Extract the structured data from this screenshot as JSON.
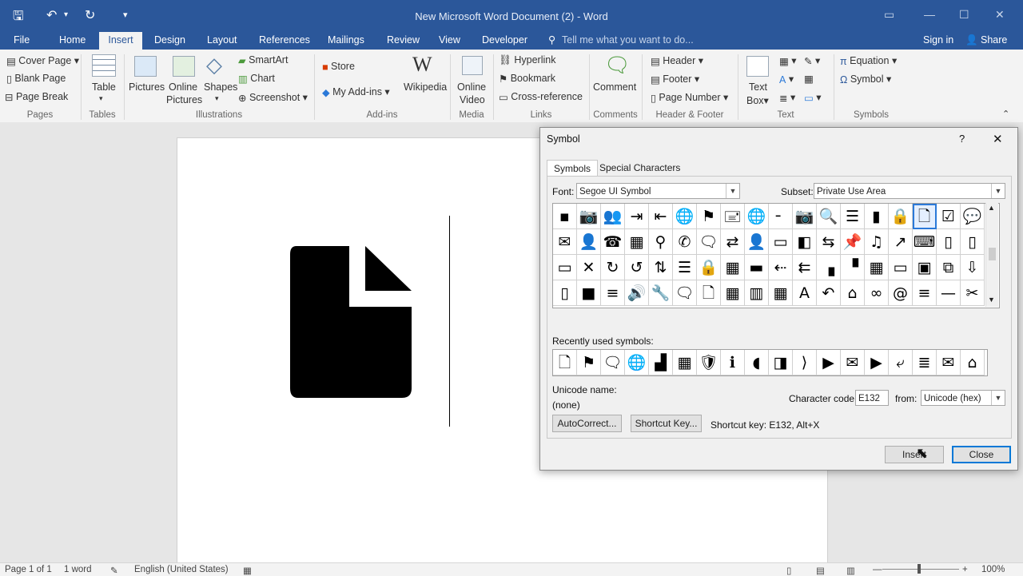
{
  "window": {
    "title": "New Microsoft Word Document (2) - Word"
  },
  "tabs": {
    "file": "File",
    "home": "Home",
    "insert": "Insert",
    "design": "Design",
    "layout": "Layout",
    "references": "References",
    "mailings": "Mailings",
    "review": "Review",
    "view": "View",
    "developer": "Developer",
    "tell_me": "Tell me what you want to do...",
    "sign_in": "Sign in",
    "share": "Share"
  },
  "ribbon": {
    "pages": {
      "cover_page": "Cover Page",
      "blank_page": "Blank Page",
      "page_break": "Page Break",
      "label": "Pages"
    },
    "tables": {
      "table": "Table",
      "label": "Tables"
    },
    "illustrations": {
      "pictures": "Pictures",
      "online_pictures_1": "Online",
      "online_pictures_2": "Pictures",
      "shapes": "Shapes",
      "smartart": "SmartArt",
      "chart": "Chart",
      "screenshot": "Screenshot",
      "label": "Illustrations"
    },
    "addins": {
      "store": "Store",
      "my_addins": "My Add-ins",
      "wikipedia": "Wikipedia",
      "label": "Add-ins"
    },
    "media": {
      "online_video_1": "Online",
      "online_video_2": "Video",
      "label": "Media"
    },
    "links": {
      "hyperlink": "Hyperlink",
      "bookmark": "Bookmark",
      "cross_reference": "Cross-reference",
      "label": "Links"
    },
    "comments": {
      "comment": "Comment",
      "label": "Comments"
    },
    "header_footer": {
      "header": "Header",
      "footer": "Footer",
      "page_number": "Page Number",
      "label": "Header & Footer"
    },
    "text": {
      "text_box_1": "Text",
      "text_box_2": "Box",
      "label": "Text"
    },
    "symbols": {
      "equation": "Equation",
      "symbol": "Symbol",
      "label": "Symbols"
    }
  },
  "dialog": {
    "title": "Symbol",
    "help": "?",
    "tab_symbols": "Symbols",
    "tab_special": "Special Characters",
    "font_label": "Font:",
    "font_value": "Segoe UI Symbol",
    "subset_label": "Subset:",
    "subset_value": "Private Use Area",
    "grid_rows": [
      [
        "▪",
        "📷",
        "👥",
        "⇥",
        "⇤",
        "🌐",
        "⚑",
        "🖃",
        "🌐",
        "╴",
        "📷",
        "🔍",
        "☰",
        "▮",
        "🔒",
        "🗋",
        "☑",
        "💬"
      ],
      [
        "✉",
        "👤",
        "☎",
        "▦",
        "⚲",
        "✆",
        "🗨",
        "⇄",
        "👤",
        "▭",
        "◧",
        "⇆",
        "📌",
        "♫",
        "↗",
        "⌨",
        "▯",
        "▯"
      ],
      [
        "▭",
        "✕",
        "↻",
        "↺",
        "⇅",
        "☰",
        "🔒",
        "▦",
        "▬",
        "⇠",
        "⇇",
        "▗",
        "▝",
        "▦",
        "▭",
        "▣",
        "⧉",
        "⇩"
      ],
      [
        "▯",
        "■",
        "≡",
        "🔊",
        "🔧",
        "🗨",
        "🗋",
        "▦",
        "▥",
        "▦",
        "A",
        "↶",
        "⌂",
        "∞",
        "@",
        "≡",
        "—",
        "✂"
      ]
    ],
    "recent_label": "Recently used symbols:",
    "recent": [
      "🗋",
      "⚑",
      "🗨",
      "🌐",
      "▟",
      "▦",
      "🛡",
      "ℹ",
      "◖",
      "◨",
      "⟩",
      "▶",
      "✉",
      "▶",
      "⤶",
      "≣",
      "✉",
      "⌂"
    ],
    "unicode_name_label": "Unicode name:",
    "unicode_name_value": "(none)",
    "char_code_label": "Character code:",
    "char_code_value": "E132",
    "from_label": "from:",
    "from_value": "Unicode (hex)",
    "autocorrect": "AutoCorrect...",
    "shortcut_key_btn": "Shortcut Key...",
    "shortcut_text": "Shortcut key: E132, Alt+X",
    "insert": "Insert",
    "close": "Close"
  },
  "statusbar": {
    "page": "Page 1 of 1",
    "words": "1 word",
    "language": "English (United States)",
    "zoom": "100%"
  },
  "colors": {
    "brand": "#2b579a",
    "selected": "#2b79d8"
  }
}
